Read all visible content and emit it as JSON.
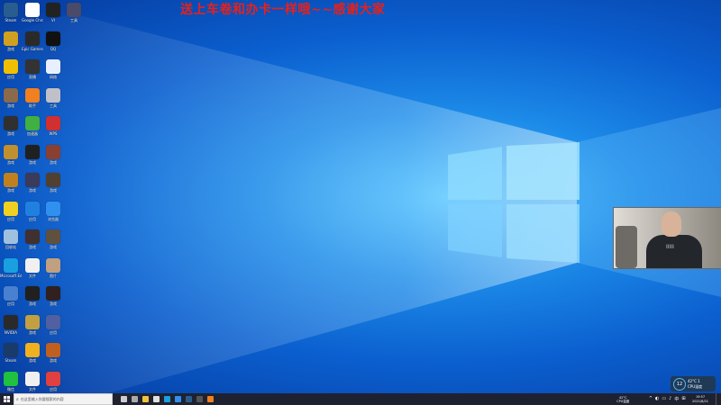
{
  "overlay": {
    "text": "送上车卷和办卡一样哦~~感谢大家"
  },
  "colors": {
    "overlay_text": "#e8201a",
    "taskbar": "#1e2230",
    "desktop_blue": "#0b5fcf"
  },
  "desktop_icons": [
    {
      "name": "steam-icon",
      "color": "#2a5d8f",
      "label": "Steam"
    },
    {
      "name": "chrome-icon",
      "color": "#ffffff",
      "label": "Google Chrome"
    },
    {
      "name": "vi-icon",
      "color": "#222222",
      "label": "VI"
    },
    {
      "name": "app-icon",
      "color": "#4a4a6a",
      "label": "工具"
    },
    {
      "name": "game-icon",
      "color": "#d0a020",
      "label": "游戏"
    },
    {
      "name": "epic-icon",
      "color": "#2a2a2a",
      "label": "Epic Games"
    },
    {
      "name": "qq-icon",
      "color": "#111111",
      "label": "QQ"
    },
    {
      "name": "yellow-app-icon",
      "color": "#f0c000",
      "label": "应用"
    },
    {
      "name": "camera-icon",
      "color": "#333333",
      "label": "直播"
    },
    {
      "name": "network-icon",
      "color": "#e8f0ff",
      "label": "网络"
    },
    {
      "name": "character-icon",
      "color": "#8a6a4a",
      "label": "游戏"
    },
    {
      "name": "orange-app-icon",
      "color": "#f08020",
      "label": "助手"
    },
    {
      "name": "tool-icon",
      "color": "#c0c0c8",
      "label": "工具"
    },
    {
      "name": "game-icon",
      "color": "#303030",
      "label": "游戏"
    },
    {
      "name": "green-app-icon",
      "color": "#40b040",
      "label": "加速器"
    },
    {
      "name": "wps-icon",
      "color": "#d03030",
      "label": "WPS"
    },
    {
      "name": "game-icon",
      "color": "#c09030",
      "label": "游戏"
    },
    {
      "name": "game-icon",
      "color": "#202020",
      "label": "游戏"
    },
    {
      "name": "game-icon",
      "color": "#8a4030",
      "label": "游戏"
    },
    {
      "name": "game-icon",
      "color": "#c08020",
      "label": "游戏"
    },
    {
      "name": "game-icon",
      "color": "#3a3a5a",
      "label": "游戏"
    },
    {
      "name": "game-icon",
      "color": "#504030",
      "label": "游戏"
    },
    {
      "name": "yellow-app-icon",
      "color": "#f0d020",
      "label": "应用"
    },
    {
      "name": "blue-app-icon",
      "color": "#2080e0",
      "label": "应用"
    },
    {
      "name": "browser-icon",
      "color": "#3090f0",
      "label": "浏览器"
    },
    {
      "name": "recycle-bin-icon",
      "color": "#a0c0e0",
      "label": "回收站"
    },
    {
      "name": "game-icon",
      "color": "#403030",
      "label": "游戏"
    },
    {
      "name": "game-icon",
      "color": "#605040",
      "label": "游戏"
    },
    {
      "name": "edge-icon",
      "color": "#1a9fe0",
      "label": "Microsoft Edge"
    },
    {
      "name": "file-icon",
      "color": "#f0f0f0",
      "label": "文件"
    },
    {
      "name": "image-icon",
      "color": "#c0a080",
      "label": "图片"
    },
    {
      "name": "app-icon",
      "color": "#4a80d0",
      "label": "应用"
    },
    {
      "name": "game-icon",
      "color": "#202020",
      "label": "游戏"
    },
    {
      "name": "game-icon",
      "color": "#302020",
      "label": "游戏"
    },
    {
      "name": "nvidia-icon",
      "color": "#2a2a2a",
      "label": "NVIDIA"
    },
    {
      "name": "game-icon",
      "color": "#c0a040",
      "label": "游戏"
    },
    {
      "name": "app-icon",
      "color": "#5060a0",
      "label": "应用"
    },
    {
      "name": "steam-icon",
      "color": "#1a3a6a",
      "label": "Steam"
    },
    {
      "name": "game-icon",
      "color": "#f0b020",
      "label": "游戏"
    },
    {
      "name": "game-icon",
      "color": "#c06020",
      "label": "游戏"
    },
    {
      "name": "wechat-icon",
      "color": "#20c040",
      "label": "微信"
    },
    {
      "name": "file-icon",
      "color": "#f0f0f0",
      "label": "文件"
    },
    {
      "name": "app-icon",
      "color": "#e04040",
      "label": "应用"
    }
  ],
  "webcam": {
    "shirt_text": "IIIII"
  },
  "hw_widget": {
    "value": "12",
    "line1": "42°C 1",
    "line2": "CPU温度"
  },
  "taskbar": {
    "search_placeholder": "在这里输入你要搜索的内容",
    "apps": [
      {
        "name": "task-view-icon",
        "color": "#cccccc"
      },
      {
        "name": "grid-app-icon",
        "color": "#aaaaaa"
      },
      {
        "name": "file-explorer-icon",
        "color": "#f0c040"
      },
      {
        "name": "store-icon",
        "color": "#e0e0e0"
      },
      {
        "name": "edge-icon",
        "color": "#1a9fe0"
      },
      {
        "name": "browser-icon",
        "color": "#3090f0"
      },
      {
        "name": "steam-icon",
        "color": "#2a5d8f"
      },
      {
        "name": "game-icon",
        "color": "#555555"
      },
      {
        "name": "orange-app-icon",
        "color": "#f08020"
      }
    ],
    "weather_line1": "42°C",
    "weather_line2": "CPU温度",
    "tray_icons": [
      "^",
      "◐",
      "▭",
      "♪",
      "中",
      "⊞"
    ],
    "clock_time": "19:57",
    "clock_date": "2021/8/21"
  }
}
